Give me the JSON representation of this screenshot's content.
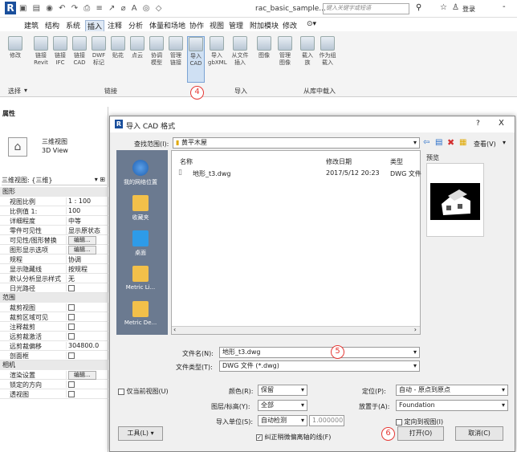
{
  "app": {
    "logo": "R",
    "filename": "rac_basic_sample...",
    "search_placeholder": "键入关键字或短语",
    "login": "登录"
  },
  "menu": [
    "建筑",
    "结构",
    "系统",
    "插入",
    "注释",
    "分析",
    "体量和场地",
    "协作",
    "视图",
    "管理",
    "附加模块",
    "修改"
  ],
  "ribbon": {
    "buttons": [
      "修改",
      "链接 Revit",
      "链接 IFC",
      "链接 CAD",
      "DWF 标记",
      "贴花",
      "点云",
      "协调 模型",
      "管理 链接",
      "导入 CAD",
      "导入 gbXML",
      "从文件 插入",
      "图像",
      "管理 图像",
      "载入 族",
      "作为组 载入"
    ],
    "panel_select": "选择",
    "panel_link": "链接",
    "panel_import": "导入",
    "panel_load": "从库中载入",
    "accent": "#e53935"
  },
  "properties": {
    "title": "属性",
    "type_line1": "三维视图",
    "type_line2": "3D View",
    "selector": "三维视图: {三维}",
    "edit_type": "编辑类型",
    "sections": {
      "graphics": "图形",
      "extents": "范围",
      "camera": "相机"
    },
    "graphics_rows": [
      {
        "k": "视图比例",
        "v": "1 : 100"
      },
      {
        "k": "比例值 1:",
        "v": "100"
      },
      {
        "k": "详细程度",
        "v": "中等"
      },
      {
        "k": "零件可见性",
        "v": "显示原状态"
      },
      {
        "k": "可见性/图形替换",
        "v": "编辑..."
      },
      {
        "k": "图形显示选项",
        "v": "编辑..."
      },
      {
        "k": "规程",
        "v": "协调"
      },
      {
        "k": "显示隐藏线",
        "v": "按规程"
      },
      {
        "k": "默认分析显示样式",
        "v": "无"
      },
      {
        "k": "日光路径",
        "v": ""
      }
    ],
    "extents_rows": [
      {
        "k": "裁剪视图",
        "v": ""
      },
      {
        "k": "裁剪区域可见",
        "v": ""
      },
      {
        "k": "注释裁剪",
        "v": ""
      },
      {
        "k": "远剪裁激活",
        "v": ""
      },
      {
        "k": "远剪裁偏移",
        "v": "304800.0"
      },
      {
        "k": "剖面框",
        "v": ""
      }
    ],
    "camera_rows": [
      {
        "k": "渲染设置",
        "v": "编辑..."
      },
      {
        "k": "锁定的方向",
        "v": ""
      },
      {
        "k": "透视图",
        "v": ""
      }
    ]
  },
  "dialog": {
    "title": "导入 CAD 格式",
    "help": "?",
    "close": "X",
    "lookin_label": "查找范围(I):",
    "lookin_value": "黄平木屋",
    "views_label": "查看(V)",
    "preview_label": "预览",
    "places": [
      "我的网络位置",
      "收藏夹",
      "桌面",
      "Metric Li...",
      "Metric De..."
    ],
    "columns": {
      "name": "名称",
      "date": "修改日期",
      "type": "类型"
    },
    "files": [
      {
        "name": "地形_t3.dwg",
        "date": "2017/5/12 20:23",
        "type": "DWG 文件"
      }
    ],
    "filename_label": "文件名(N):",
    "filename_value": "地形_t3.dwg",
    "filetype_label": "文件类型(T):",
    "filetype_value": "DWG 文件 (*.dwg)",
    "current_view_only": "仅当前视图(U)",
    "colors_label": "颜色(R):",
    "colors_value": "保留",
    "layers_label": "图层/标高(Y):",
    "layers_value": "全部",
    "units_label": "导入单位(S):",
    "units_value": "自动检测",
    "units_scale": "1.000000",
    "correct_lines": "纠正稍微偏离轴的线(F)",
    "positioning_label": "定位(P):",
    "positioning_value": "自动 - 原点到原点",
    "placeat_label": "放置于(A):",
    "placeat_value": "Foundation",
    "orient_view": "定向到视图(I)",
    "tools_button": "工具(L)",
    "open_button": "打开(O)",
    "cancel_button": "取消(C)"
  },
  "markers": {
    "m4": "4",
    "m5": "5",
    "m6": "6"
  }
}
